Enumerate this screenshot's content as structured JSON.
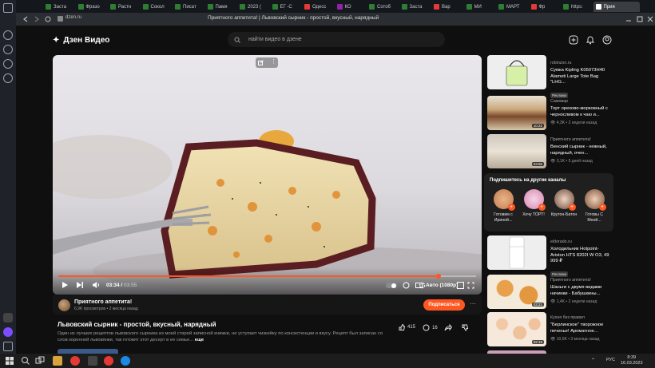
{
  "browser": {
    "tabs": [
      {
        "label": "Заста",
        "color": "#2e7d32"
      },
      {
        "label": "Фразо",
        "color": "#2e7d32"
      },
      {
        "label": "Растн",
        "color": "#2e7d32"
      },
      {
        "label": "Сокол",
        "color": "#2e7d32"
      },
      {
        "label": "Писат",
        "color": "#2e7d32"
      },
      {
        "label": "Памя",
        "color": "#2e7d32"
      },
      {
        "label": "2023 (",
        "color": "#2e7d32"
      },
      {
        "label": "ЕГ -С",
        "color": "#2e7d32"
      },
      {
        "label": "Одесс",
        "color": "#e53935"
      },
      {
        "label": "КО",
        "color": "#8e24aa"
      },
      {
        "label": "Сотоб",
        "color": "#2e7d32"
      },
      {
        "label": "Заста",
        "color": "#2e7d32"
      },
      {
        "label": "Вар",
        "color": "#e53935"
      },
      {
        "label": "МИ",
        "color": "#2e7d32"
      },
      {
        "label": "МАРТ",
        "color": "#2e7d32"
      },
      {
        "label": "Фр",
        "color": "#e53935"
      },
      {
        "label": "https:",
        "color": "#2e7d32"
      },
      {
        "label": "Прия",
        "color": "#ffffff"
      }
    ],
    "window_title": "Приятного аппетита! | Львовский сырник - простой, вкусный, нарядный",
    "url": "dzen.ru"
  },
  "header": {
    "logo_text": "Дзен Видео",
    "search_placeholder": "найти видео в дзене"
  },
  "player": {
    "current_time": "03:34",
    "total_time": "03:55",
    "progress_fraction": 0.91,
    "quality": "Авто (1080p)"
  },
  "channel": {
    "name": "Приятного аппетита!",
    "stats": "6,9K просмотров • 2 месяца назад",
    "subscribe_label": "Подписаться"
  },
  "video": {
    "title": "Львовский сырник - простой, вкусный, нарядный",
    "description": "Один из лучших рецептов львовского сырника из моей старой записной книжки, не уступает чизкейку по консистенции и вкусу. Рецепт был записан со слов коренной львовянки, так готовят этот десерт в ее семье...",
    "more_label": "еще",
    "likes": "415",
    "comments": "16"
  },
  "recommendations": [
    {
      "source": "robinzon.ru",
      "title": "Сумка Kipling K05073H40 Alameti Large Tote Bag \"LHG...",
      "meta": "",
      "ad": "Реклама",
      "duration": ""
    },
    {
      "source": "Самовар",
      "title": "Торт орехово-морковный с черносливом к чаю и...",
      "meta": "4,3K • 2 недели назад",
      "ad": "",
      "duration": "10:22"
    },
    {
      "source": "Приятного аппетита!",
      "title": "Венский сырник - нежный, нарядный, очен...",
      "meta": "3,1K • 5 дней назад",
      "ad": "",
      "duration": "03:56"
    },
    {
      "source": "eldorado.ru",
      "title": "Холодильник Hotpoint-Ariston HTS 8202I W O3, 49 999 ₽",
      "meta": "",
      "ad": "Реклама",
      "duration": ""
    },
    {
      "source": "Приятного аппетита!",
      "title": "Шаньги с двумя видами начинки - Бабушкины...",
      "meta": "1,4K • 2 недели назад",
      "ad": "",
      "duration": "03:21"
    },
    {
      "source": "Кухня без правил",
      "title": "\"Берлинское\" творожное печенье! Ароматное...",
      "meta": "10,5K • 3 месяца назад",
      "ad": "",
      "duration": "02:19"
    }
  ],
  "subscribe_block": {
    "heading": "Подпишитесь на другие каналы",
    "channels": [
      "Готовим с Ириной...",
      "Хочу ТОРТ!",
      "Крутон-Батон",
      "Готовы С Мной..."
    ]
  },
  "taskbar": {
    "lang": "РУС",
    "time": "8:39",
    "date": "16.03.2023"
  }
}
